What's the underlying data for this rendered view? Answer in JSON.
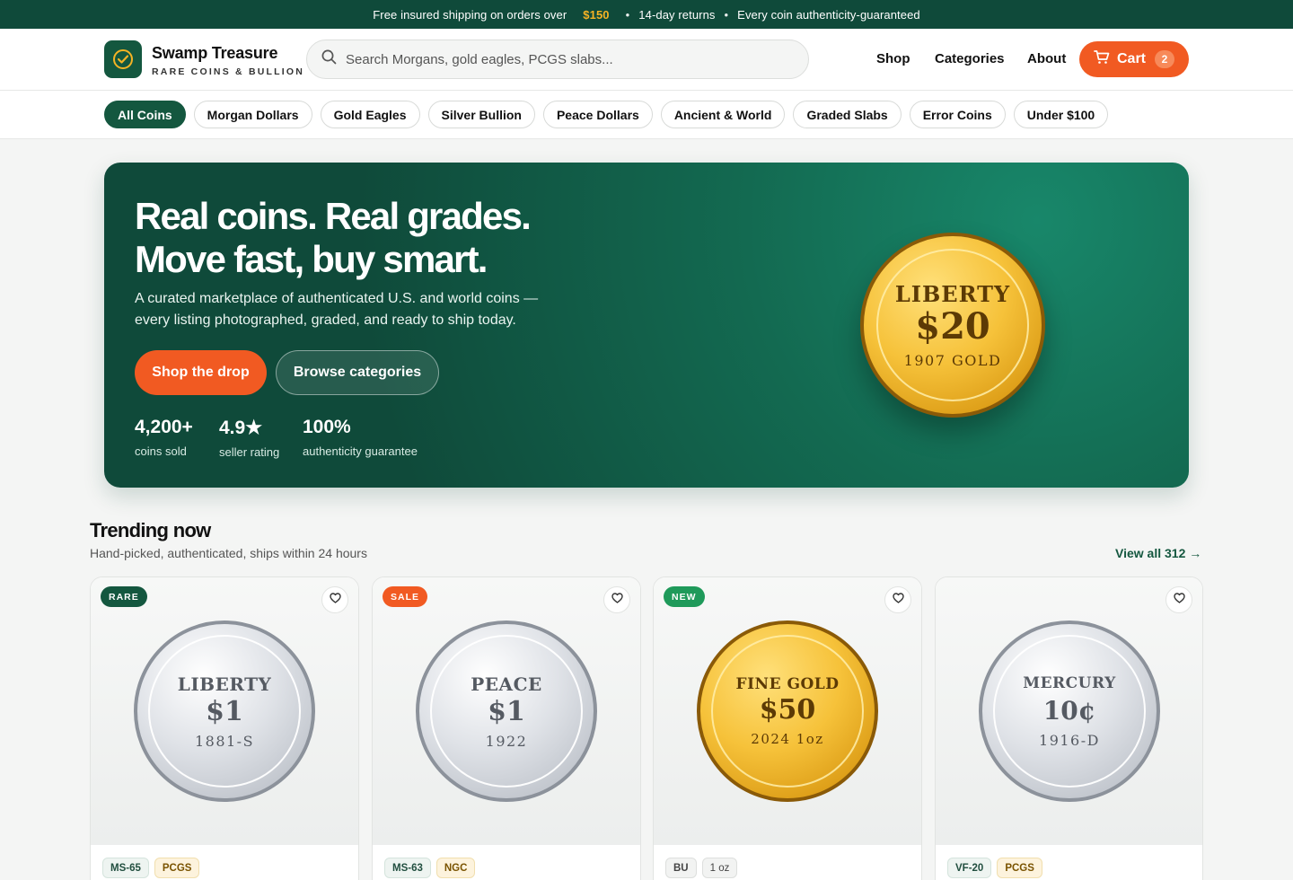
{
  "announcement": {
    "text_before": "Free insured shipping on orders over",
    "price": "$150",
    "item2": "14-day returns",
    "item3": "Every coin authenticity-guaranteed",
    "separator": "•"
  },
  "brand": {
    "name": "Swamp Treasure",
    "tagline": "RARE COINS & BULLION"
  },
  "search": {
    "placeholder": "Search Morgans, gold eagles, PCGS slabs..."
  },
  "nav": {
    "shop": "Shop",
    "categories": "Categories",
    "about": "About",
    "cart_label": "Cart",
    "cart_count": "2"
  },
  "chips": [
    "All Coins",
    "Morgan Dollars",
    "Gold Eagles",
    "Silver Bullion",
    "Peace Dollars",
    "Ancient & World",
    "Graded Slabs",
    "Error Coins",
    "Under $100"
  ],
  "hero": {
    "title_line1": "Real coins. Real grades.",
    "title_line2": "Move fast, buy smart.",
    "subtitle": "A curated marketplace of authenticated U.S. and world coins — every listing photographed, graded, and ready to ship today.",
    "primary_cta": "Shop the drop",
    "secondary_cta": "Browse categories",
    "stats": [
      {
        "value": "4,200+",
        "label": "coins sold"
      },
      {
        "value": "4.9★",
        "label": "seller rating"
      },
      {
        "value": "100%",
        "label": "authenticity guarantee"
      }
    ],
    "coin": {
      "top": "LIBERTY",
      "mid": "$20",
      "bottom": "1907 GOLD"
    }
  },
  "trending": {
    "title": "Trending now",
    "subtitle": "Hand-picked, authenticated, ships within 24 hours",
    "view_all": "View all 312 →",
    "products": [
      {
        "badge": "RARE",
        "coin_top": "LIBERTY",
        "coin_mid": "$1",
        "coin_bottom": "1881-S",
        "tag1": "MS-65",
        "tag2": "PCGS"
      },
      {
        "badge": "SALE",
        "coin_top": "PEACE",
        "coin_mid": "$1",
        "coin_bottom": "1922",
        "tag1": "MS-63",
        "tag2": "NGC"
      },
      {
        "badge": "NEW",
        "coin_top": "FINE GOLD",
        "coin_mid": "$50",
        "coin_bottom": "2024 1oz",
        "tag1": "BU",
        "tag2": "1 oz"
      },
      {
        "badge": "",
        "coin_top": "MERCURY",
        "coin_mid": "10¢",
        "coin_bottom": "1916-D",
        "tag1": "VF-20",
        "tag2": "PCGS"
      }
    ]
  },
  "colors": {
    "brand_green": "#14573f",
    "accent_orange": "#f15a22",
    "gold_price": "#f5b324",
    "badge_rare": "#14573f",
    "badge_sale": "#f15a22",
    "badge_new": "#1f9a5a"
  },
  "icons": {
    "logo": "check-circle-icon",
    "search": "search-icon",
    "cart": "cart-icon",
    "favorite": "heart-icon"
  }
}
